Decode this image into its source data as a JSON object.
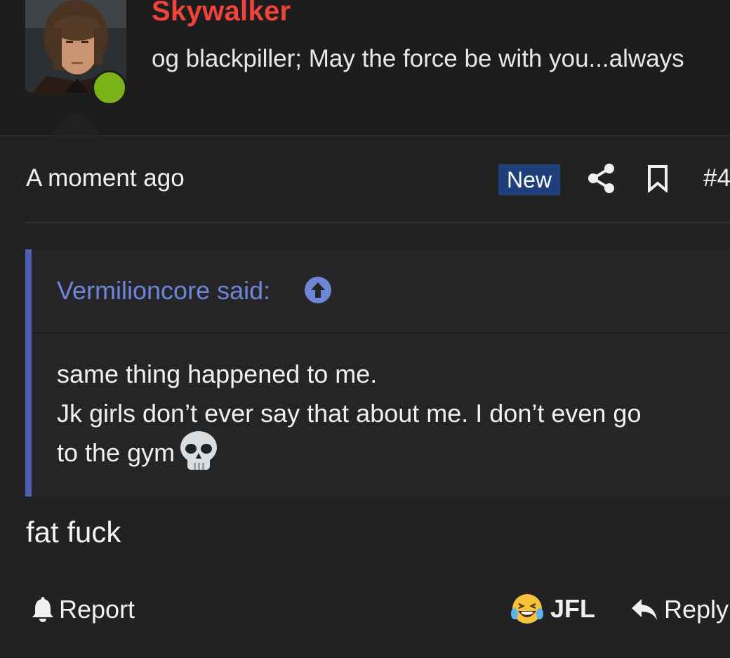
{
  "user": {
    "name": "Skywalker",
    "title": "og blackpiller; May the force be with you...always",
    "online": true
  },
  "post": {
    "time": "A moment ago",
    "badge": "New",
    "number": "#4",
    "body": "fat fuck"
  },
  "quote": {
    "author": "Vermilioncore said:",
    "lines": [
      "same thing happened to me.",
      "Jk girls don’t ever say that about me. I don’t even go",
      "to the gym"
    ]
  },
  "actions": {
    "report": "Report",
    "reaction": "JFL",
    "reply": "Reply"
  },
  "colors": {
    "username": "#f0443a",
    "quote_accent": "#4f5fb4",
    "badge_bg": "#1e3f7a",
    "online": "#7ab317"
  },
  "icons": [
    "share-icon",
    "bookmark-icon",
    "arrow-up-circle-icon",
    "skull-emoji-icon",
    "bell-icon",
    "laughing-crying-emoji-icon",
    "reply-arrow-icon"
  ]
}
